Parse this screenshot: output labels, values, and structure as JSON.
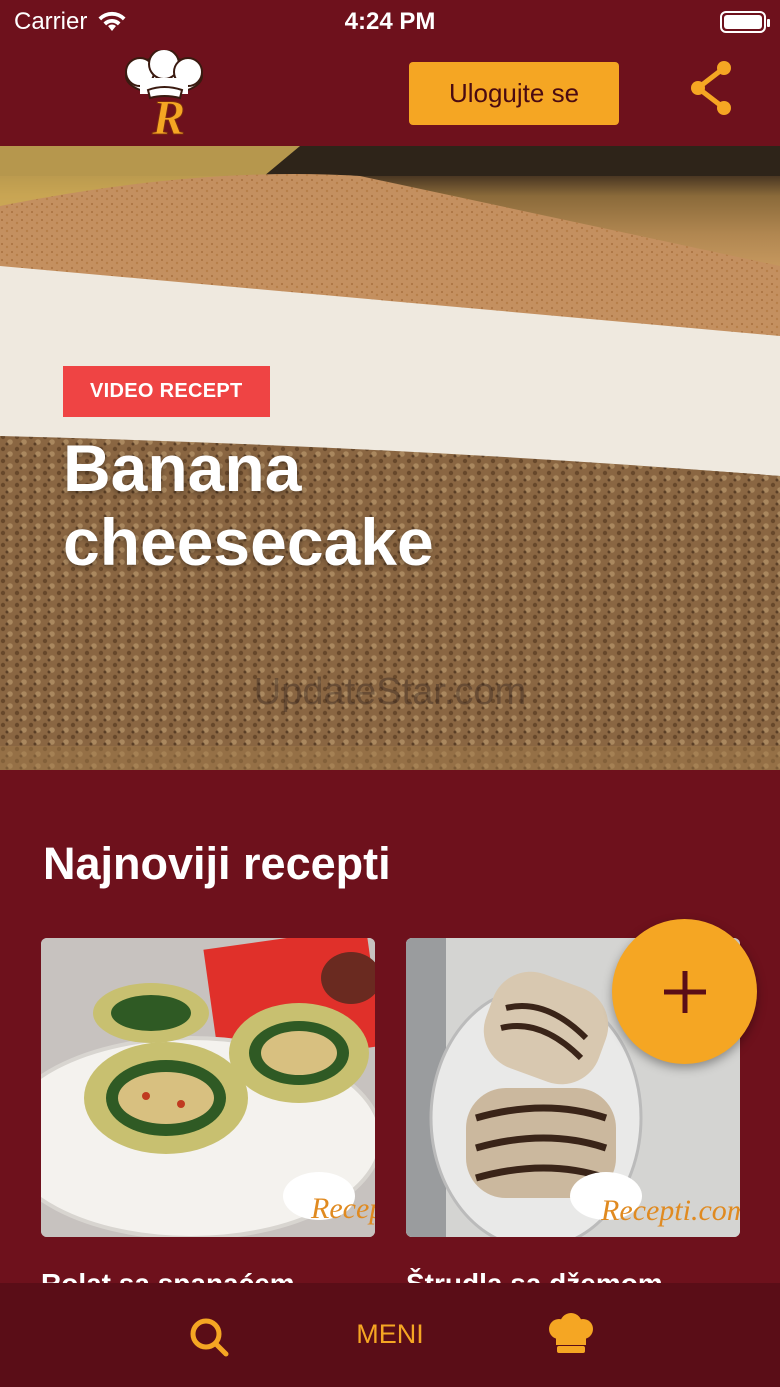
{
  "status_bar": {
    "carrier": "Carrier",
    "time": "4:24 PM"
  },
  "header": {
    "logo_icon": "chef-hat-r-logo",
    "login_label": "Ulogujte se",
    "share_icon": "share-icon"
  },
  "hero": {
    "badge": "VIDEO RECEPT",
    "title": "Banana cheesecake",
    "watermark": "UpdateStar.com"
  },
  "section": {
    "title": "Najnoviji recepti"
  },
  "cards": [
    {
      "title": "Rolat sa spanaćem",
      "image_watermark": "Recepti.com"
    },
    {
      "title": "Štrudla sa džemom",
      "image_watermark": "Recepti.com"
    }
  ],
  "fab": {
    "icon": "plus-icon"
  },
  "bottom_nav": {
    "search_icon": "search-icon",
    "menu_label": "MENI",
    "chef_icon": "chef-hat-icon"
  },
  "colors": {
    "background": "#6e111c",
    "accent": "#f5a623",
    "badge": "#ef4444",
    "nav_background": "#5a0d17"
  }
}
